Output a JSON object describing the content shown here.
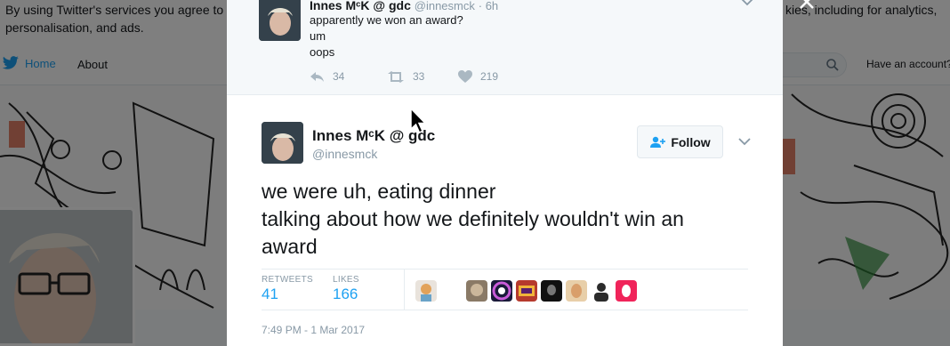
{
  "background": {
    "cookie_left": "By using Twitter's services you agree to personalisation, and ads.",
    "cookie_right": "kies, including for analytics,",
    "nav_home": "Home",
    "nav_about": "About",
    "nav_account": "Have an account?"
  },
  "ancestor_tweet": {
    "name": "Innes MᶜK @ gdc",
    "handle": "@innesmck",
    "time": "· 6h",
    "lines": [
      "apparently we won an award?",
      "um",
      "oops"
    ],
    "replies": "34",
    "retweets": "33",
    "likes": "219"
  },
  "main_tweet": {
    "name": "Innes MᶜK @ gdc",
    "handle": "@innesmck",
    "follow_label": "Follow",
    "lines": [
      "we were uh, eating dinner",
      "talking about how we definitely wouldn't win an",
      "award"
    ],
    "retweets_label": "RETWEETS",
    "retweets_count": "41",
    "likes_label": "LIKES",
    "likes_count": "166",
    "timestamp": "7:49 PM - 1 Mar 2017"
  },
  "colors": {
    "accent": "#1da1f2",
    "muted": "#8899a6",
    "text": "#14171a"
  }
}
